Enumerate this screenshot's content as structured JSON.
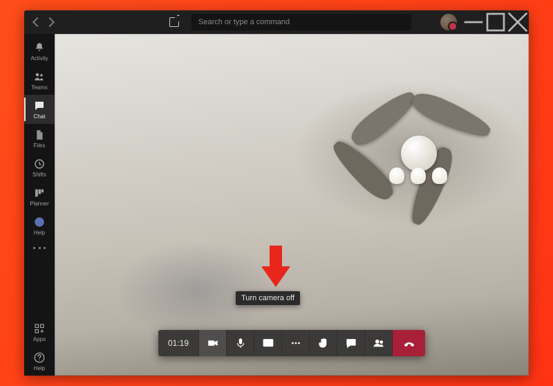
{
  "titlebar": {
    "search_placeholder": "Search or type a command"
  },
  "rail": {
    "items": [
      {
        "label": "Activity",
        "icon": "bell"
      },
      {
        "label": "Teams",
        "icon": "teams"
      },
      {
        "label": "Chat",
        "icon": "chat"
      },
      {
        "label": "Files",
        "icon": "files"
      },
      {
        "label": "Shifts",
        "icon": "shifts"
      },
      {
        "label": "Planner",
        "icon": "planner"
      },
      {
        "label": "Help",
        "icon": "help"
      }
    ],
    "bottom": [
      {
        "label": "Apps",
        "icon": "apps"
      },
      {
        "label": "Help",
        "icon": "helpq"
      }
    ]
  },
  "call": {
    "timer": "01:19",
    "tooltip": "Turn camera off",
    "colors": {
      "hangup": "#a72037"
    }
  }
}
